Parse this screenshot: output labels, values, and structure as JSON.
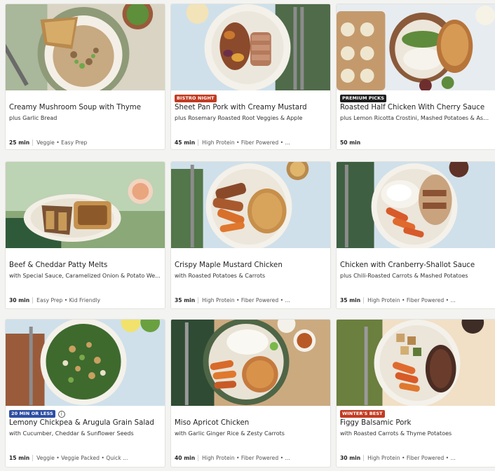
{
  "colors": {
    "bistro": "#c23b22",
    "premium": "#1f1f1f",
    "quick": "#2e4fa3",
    "winter": "#c23b22"
  },
  "recipes": [
    {
      "title": "Creamy Mushroom Soup with Thyme",
      "subtitle": "plus Garlic Bread",
      "time": "25 min",
      "tags": "Veggie • Easy Prep",
      "badge": ""
    },
    {
      "title": "Sheet Pan Pork with Creamy Mustard",
      "subtitle": "plus Rosemary Roasted Root Veggies & Apple",
      "time": "45 min",
      "tags": "High Protein • Fiber Powered • ...",
      "badge": "BISTRO NIGHT"
    },
    {
      "title": "Roasted Half Chicken With Cherry Sauce",
      "subtitle": "plus Lemon Ricotta Crostini, Mashed Potatoes & Asp...",
      "time": "50 min",
      "tags": "",
      "badge": "PREMIUM PICKS"
    },
    {
      "title": "Beef & Cheddar Patty Melts",
      "subtitle": "with Special Sauce, Caramelized Onion & Potato We...",
      "time": "30 min",
      "tags": "Easy Prep • Kid Friendly",
      "badge": ""
    },
    {
      "title": "Crispy Maple Mustard Chicken",
      "subtitle": "with Roasted Potatoes & Carrots",
      "time": "35 min",
      "tags": "High Protein • Fiber Powered • ...",
      "badge": ""
    },
    {
      "title": "Chicken with Cranberry-Shallot Sauce",
      "subtitle": "plus Chili-Roasted Carrots & Mashed Potatoes",
      "time": "35 min",
      "tags": "High Protein • Fiber Powered • ...",
      "badge": ""
    },
    {
      "title": "Lemony Chickpea & Arugula Grain Salad",
      "subtitle": "with Cucumber, Cheddar & Sunflower Seeds",
      "time": "15 min",
      "tags": "Veggie • Veggie Packed • Quick ...",
      "badge": "20 MIN OR LESS"
    },
    {
      "title": "Miso Apricot Chicken",
      "subtitle": "with Garlic Ginger Rice & Zesty Carrots",
      "time": "40 min",
      "tags": "High Protein • Fiber Powered • ...",
      "badge": ""
    },
    {
      "title": "Figgy Balsamic Pork",
      "subtitle": "with Roasted Carrots & Thyme Potatoes",
      "time": "30 min",
      "tags": "High Protein • Fiber Powered • ...",
      "badge": "WINTER'S BEST"
    }
  ]
}
